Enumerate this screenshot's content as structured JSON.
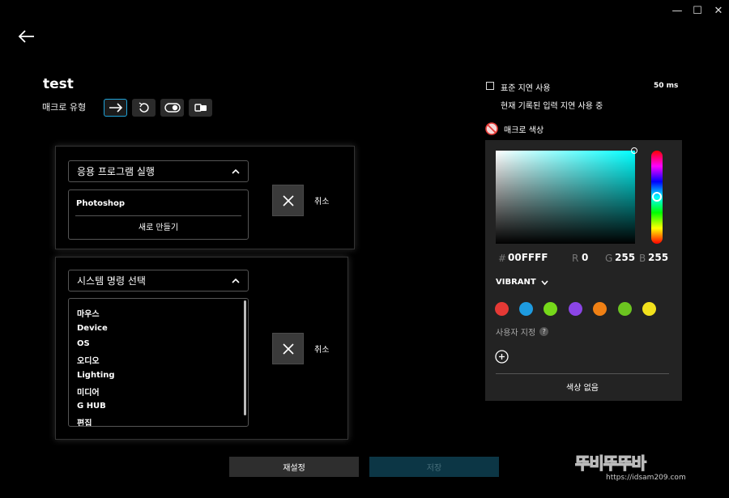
{
  "window": {
    "minimize": "—",
    "maximize": "☐",
    "close": "✕"
  },
  "macro": {
    "name": "test",
    "type_label": "매크로 유형"
  },
  "action1": {
    "dropdown_label": "응용 프로그램 실행",
    "program": "Photoshop",
    "create_new": "새로 만들기",
    "cancel_label": "취소"
  },
  "action2": {
    "dropdown_label": "시스템 명령 선택",
    "items": [
      "마우스",
      "Device",
      "OS",
      "오디오",
      "Lighting",
      "미디어",
      "G HUB",
      "편집"
    ],
    "cancel_label": "취소"
  },
  "delay": {
    "checkbox_label": "표준 지연 사용",
    "value": "50 ms",
    "note": "현재 기록된 입력 지연 사용 중"
  },
  "color": {
    "label": "매크로 색상",
    "hash": "#",
    "hex": "00FFFF",
    "r_label": "R",
    "r": "0",
    "g_label": "G",
    "g": "255",
    "b_label": "B",
    "b": "255",
    "palette_name": "VIBRANT",
    "swatches": [
      "#e53935",
      "#1e9be0",
      "#76d81a",
      "#8b45e6",
      "#f08014",
      "#6cc420",
      "#f2e11c"
    ],
    "custom_label": "사용자 지정",
    "help_icon": "?",
    "no_color": "색상 없음",
    "accent": "#00ffff"
  },
  "footer": {
    "reset": "재설정",
    "save": "저장"
  },
  "watermark": {
    "brand": "뚜비뚜뚜바",
    "url": "https://idsam209.com"
  }
}
